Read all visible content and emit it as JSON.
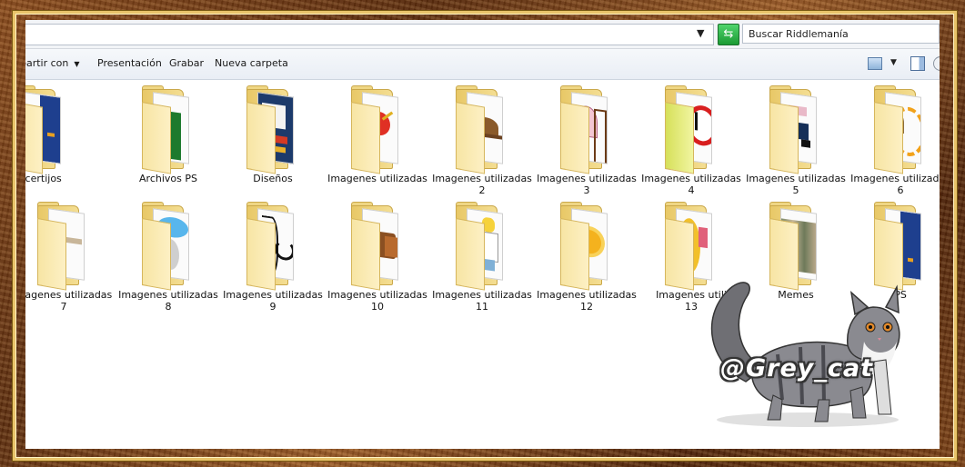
{
  "address_bar": {
    "search_placeholder": "Buscar Riddlemanía"
  },
  "toolbar": {
    "share_label": "partir con",
    "presentation_label": "Presentación",
    "burn_label": "Grabar",
    "new_folder_label": "Nueva carpeta"
  },
  "folders_row1": [
    {
      "name": "Acertijos",
      "line2": ""
    },
    {
      "name": "Archivos PS",
      "line2": ""
    },
    {
      "name": "Diseños",
      "line2": ""
    },
    {
      "name": "Imagenes utilizadas",
      "line2": ""
    },
    {
      "name": "Imagenes utilizadas",
      "line2": "2"
    },
    {
      "name": "Imagenes utilizadas",
      "line2": "3"
    },
    {
      "name": "Imagenes utilizadas",
      "line2": "4"
    },
    {
      "name": "Imagenes utilizadas",
      "line2": "5"
    },
    {
      "name": "Imagenes utilizadas",
      "line2": "6"
    }
  ],
  "folders_row2": [
    {
      "name": "magenes utilizadas",
      "line2": "7"
    },
    {
      "name": "Imagenes utilizadas",
      "line2": "8"
    },
    {
      "name": "Imagenes utilizadas",
      "line2": "9"
    },
    {
      "name": "Imagenes utilizadas",
      "line2": "10"
    },
    {
      "name": "Imagenes utilizadas",
      "line2": "11"
    },
    {
      "name": "Imagenes utilizadas",
      "line2": "12"
    },
    {
      "name": "Imagenes utili",
      "line2": "13"
    },
    {
      "name": "Memes",
      "line2": ""
    },
    {
      "name": "PS",
      "line2": ""
    }
  ],
  "watermark": "@Grey_cat",
  "colors": {
    "frame_wood": "#6b3a16",
    "frame_gold": "#e8c36a",
    "folder_yellow": "#f4de93",
    "refresh_green": "#1b9a34"
  }
}
